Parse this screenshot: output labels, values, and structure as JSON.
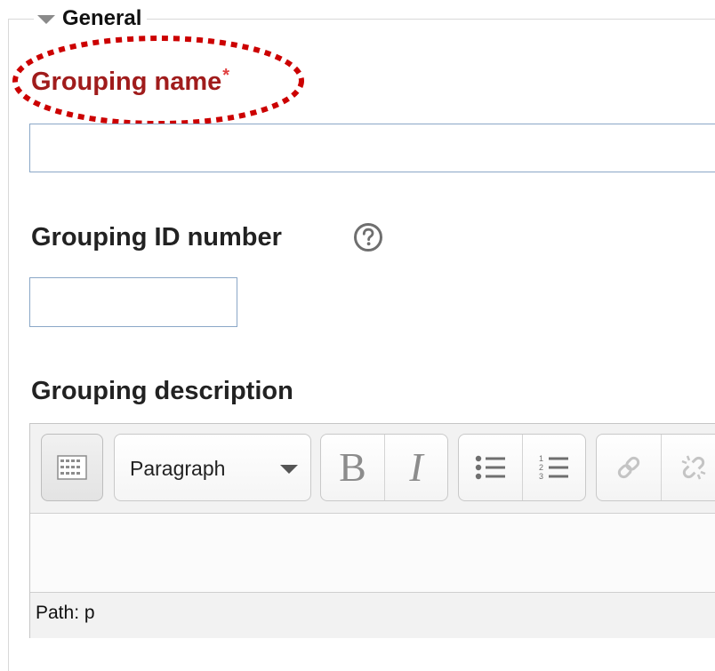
{
  "section": {
    "legend": "General",
    "collapse_icon": "triangle-down-icon"
  },
  "fields": {
    "grouping_name": {
      "label": "Grouping name",
      "required_marker": "*",
      "value": ""
    },
    "grouping_id": {
      "label": "Grouping ID number",
      "help_icon": "question-circle-icon",
      "value": ""
    },
    "grouping_description": {
      "label": "Grouping description"
    }
  },
  "editor": {
    "toolbar": {
      "toggle_icon": "toolbar-toggle-icon",
      "format_select": "Paragraph",
      "bold": "B",
      "italic": "I",
      "bullet_list_icon": "bulleted-list-icon",
      "numbered_list_icon": "numbered-list-icon",
      "link_icon": "link-icon",
      "unlink_icon": "unlink-icon"
    },
    "content": "",
    "path_label": "Path: p"
  },
  "colors": {
    "required_label": "#a01c1c",
    "required_star": "#e04040",
    "highlight": "#cc0000",
    "input_border": "#8aa7c7"
  }
}
